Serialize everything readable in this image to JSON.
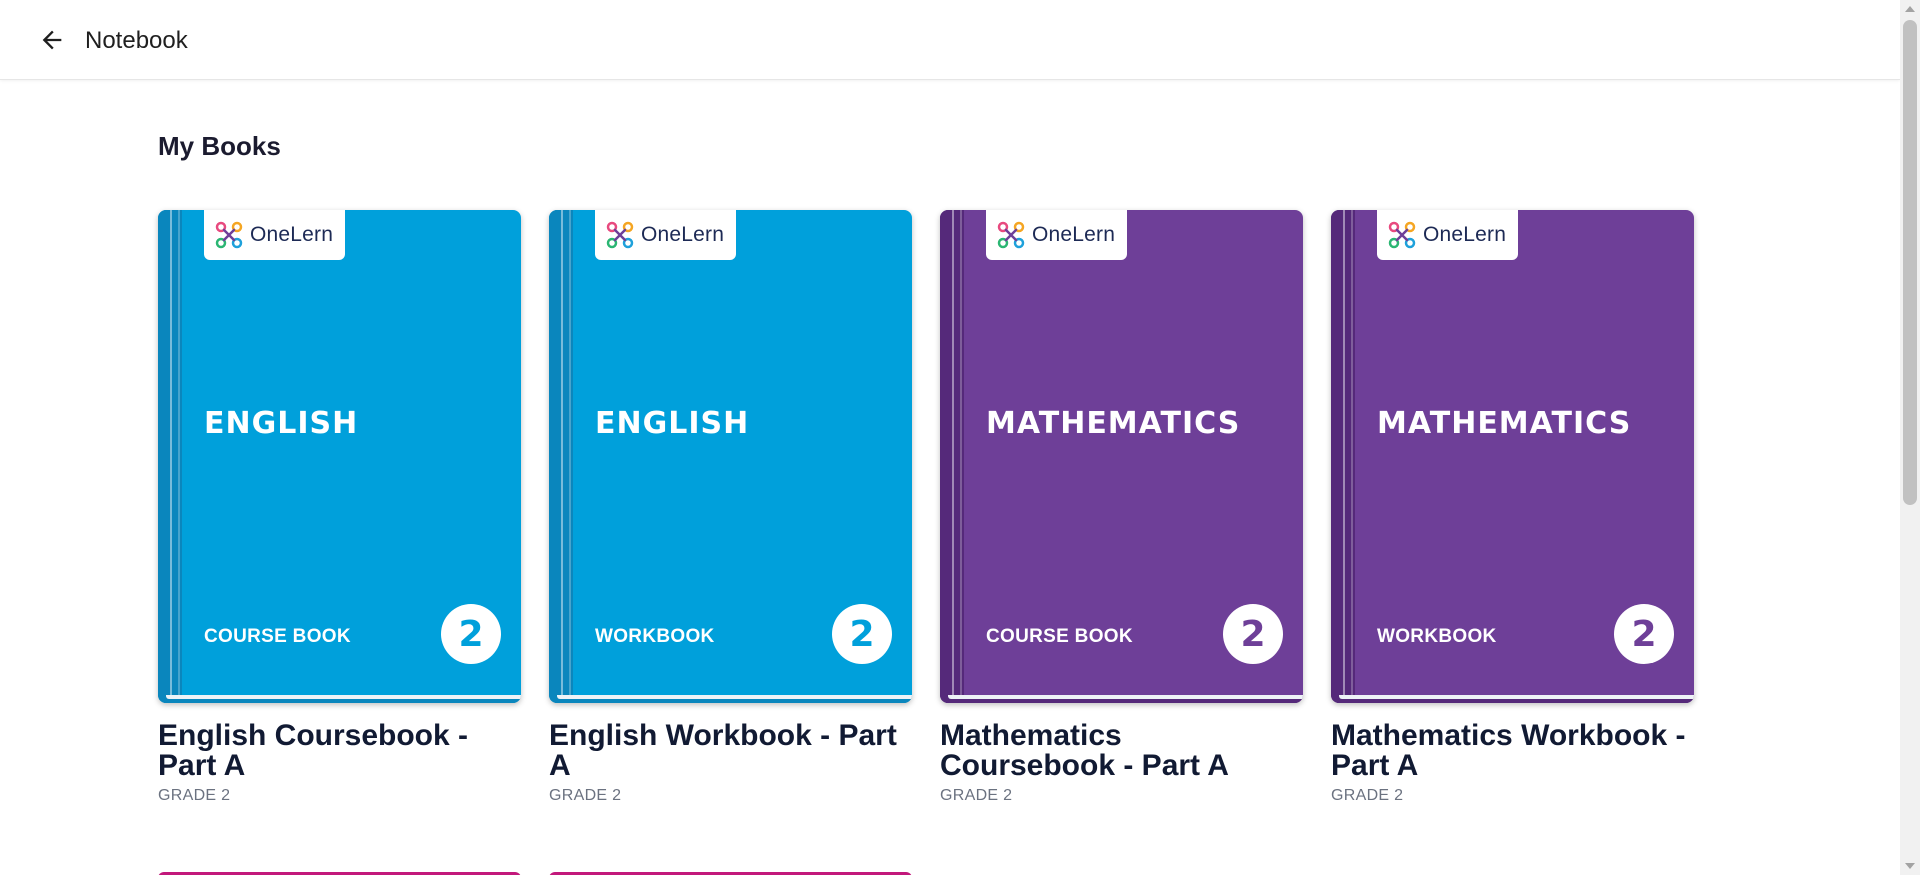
{
  "header": {
    "back_icon": "arrow-left-icon",
    "title": "Notebook"
  },
  "main": {
    "section_title": "My Books",
    "brand": {
      "logo_text": "OneLern",
      "logo_icon": "onelern-logo-icon"
    },
    "books": [
      {
        "subject": "ENGLISH",
        "book_type": "COURSE BOOK",
        "grade_number": "2",
        "title": "English Coursebook - Part A",
        "grade_label": "GRADE 2",
        "cover_color": "#00A0DB",
        "spine_color": "#0a86bd",
        "accent_color": "#00A0DB"
      },
      {
        "subject": "ENGLISH",
        "book_type": "WORKBOOK",
        "grade_number": "2",
        "title": "English Workbook - Part A",
        "grade_label": "GRADE 2",
        "cover_color": "#00A0DB",
        "spine_color": "#0a86bd",
        "accent_color": "#00A0DB"
      },
      {
        "subject": "MATHEMATICS",
        "book_type": "COURSE BOOK",
        "grade_number": "2",
        "title": "Mathematics Coursebook - Part A",
        "grade_label": "GRADE 2",
        "cover_color": "#6E3F98",
        "spine_color": "#55297a",
        "accent_color": "#6E3F98"
      },
      {
        "subject": "MATHEMATICS",
        "book_type": "WORKBOOK",
        "grade_number": "2",
        "title": "Mathematics Workbook - Part A",
        "grade_label": "GRADE 2",
        "cover_color": "#6E3F98",
        "spine_color": "#55297a",
        "accent_color": "#6E3F98"
      }
    ],
    "next_row_colors": [
      "#C2187B",
      "#C2187B"
    ]
  }
}
